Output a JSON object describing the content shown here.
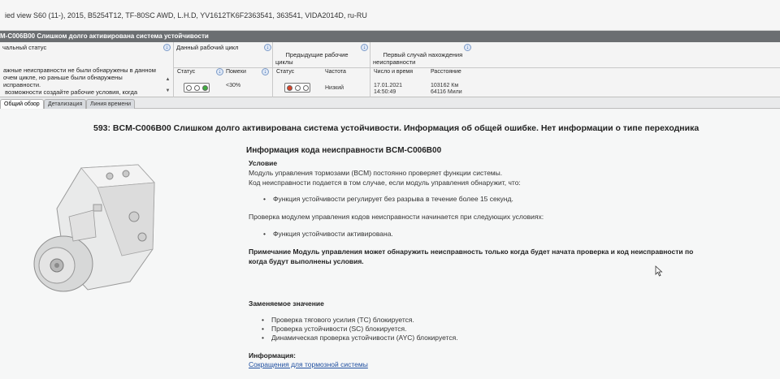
{
  "window": {
    "title": "ied view  S60 (11-), 2015, B5254T12, TF-80SC AWD, L.H.D, YV1612TK6F2363541, 363541, VIDA2014D, ru-RU"
  },
  "dtc_bar": {
    "title": "M-C006B00 Слишком долго активирована система устойчивости"
  },
  "grid": {
    "initial_status": {
      "header": "чальный статус",
      "description": "ажные неисправности не были обнаружены в данном\nочем цикле, но раньше были обнаружены\nисправности.\n возможности создайте рабочие условия, когда"
    },
    "current_cycle": {
      "header": "Данный рабочий цикл",
      "status_label": "Статус",
      "interference_label": "Помехи",
      "interference_value": "<30%",
      "lights": [
        "#ffffff",
        "#ffffff",
        "#3fae3f"
      ]
    },
    "previous_cycles": {
      "header": "Предыдущие рабочие\nциклы",
      "status_label": "Статус",
      "frequency_label": "Частота",
      "frequency_value": "Низкий",
      "lights": [
        "#d9442b",
        "#ffffff",
        "#ffffff"
      ]
    },
    "first_occurrence": {
      "header": "Первый случай нахождения\nнеисправности",
      "date_label": "Число и время",
      "date_value": "17.01.2021\n14:50:49",
      "distance_label": "Расстояние",
      "distance_value": "103162 Км\n64116 Мили"
    }
  },
  "tabs": [
    {
      "label": "Общий обзор",
      "active": true
    },
    {
      "label": "Детализация",
      "active": false
    },
    {
      "label": "Линия времени",
      "active": false
    }
  ],
  "content": {
    "heading": "593: BCM-C006B00 Слишком долго активирована система устойчивости. Информация об общей ошибке. Нет информации о типе переходника",
    "info_title": "Информация кода неисправности BCM-C006B00",
    "condition_label": "Условие",
    "condition_line1": "Модуль управления тормозами (BCM) постоянно проверяет функции системы.",
    "condition_line2": "Код неисправности подается в том случае, если модуль управления обнаружит, что:",
    "condition_bullet": "Функция устойчивости регулирует без разрыва в течение более 15 секунд.",
    "check_line": "Проверка модулем управления кодов неисправности начинается при следующих условиях:",
    "check_bullet": "Функция устойчивости активирована.",
    "note_line1": "Примечание Модуль управления может обнаружить неисправность только когда будет начата проверка и код неисправности по",
    "note_line2": "когда будут выполнены условия.",
    "substitute_label": "Заменяемое значение",
    "substitute_bullets": [
      "Проверка тягового усилия (TC) блокируется.",
      "Проверка устойчивости (SC) блокируется.",
      "Динамическая проверка устойчивости (AYC) блокируется."
    ],
    "info_label": "Информация:",
    "info_link": "Сокращения для тормозной системы"
  },
  "icons": {
    "download": "download-arrow-icon",
    "scroll_up": "scroll-up-icon",
    "scroll_down": "scroll-down-icon",
    "cursor": "mouse-cursor-icon",
    "module": "abs-module-image"
  }
}
